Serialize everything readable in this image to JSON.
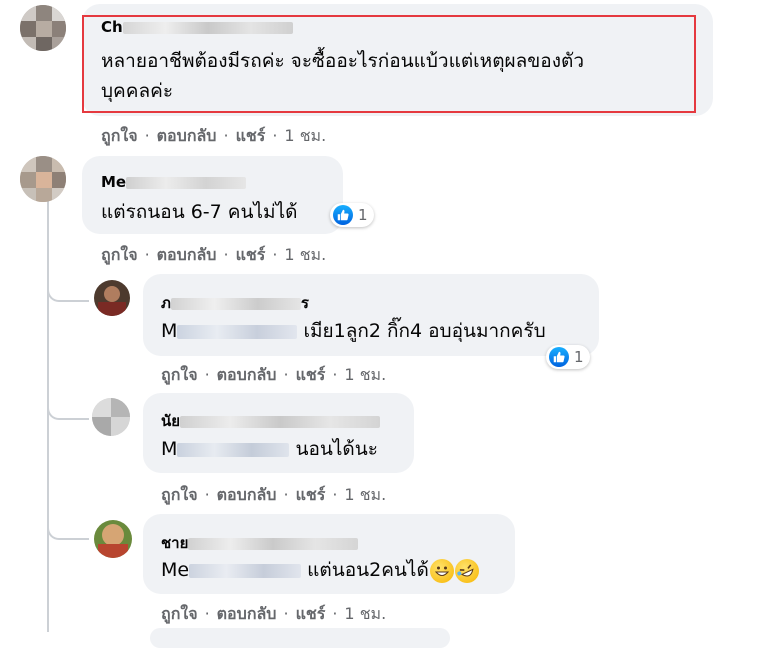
{
  "comments": [
    {
      "name_prefix": "Ch",
      "text_lines": [
        "หลายอาชีพต้องมีรถค่ะ จะซื้ออะไรก่อนแบ้วแต่เหตุผลของตัว",
        "บุคคลค่ะ"
      ],
      "actions": {
        "like": "ถูกใจ",
        "reply": "ตอบกลับ",
        "share": "แชร์",
        "time": "1 ชม."
      }
    },
    {
      "name_prefix": "Me",
      "text": "แต่รถนอน 6-7 คนไม่ได้",
      "reaction_count": "1",
      "actions": {
        "like": "ถูกใจ",
        "reply": "ตอบกลับ",
        "share": "แชร์",
        "time": "1 ชม."
      }
    }
  ],
  "replies": [
    {
      "name_prefix": "ภ",
      "name_suffix": "ร",
      "mention_prefix": "M",
      "text": "เมีย1ลูก2 กิ๊ก4 อบอุ่นมากครับ",
      "reaction_count": "1",
      "actions": {
        "like": "ถูกใจ",
        "reply": "ตอบกลับ",
        "share": "แชร์",
        "time": "1 ชม."
      }
    },
    {
      "name_prefix": "นัย",
      "mention_prefix": "M",
      "text": "นอนได้นะ",
      "actions": {
        "like": "ถูกใจ",
        "reply": "ตอบกลับ",
        "share": "แชร์",
        "time": "1 ชม."
      }
    },
    {
      "name_prefix": "ชาย",
      "mention_prefix": "Me",
      "text": "แต่นอน2คนได้",
      "emojis": [
        "grinning-face-icon",
        "rolling-laughing-icon"
      ],
      "actions": {
        "like": "ถูกใจ",
        "reply": "ตอบกลับ",
        "share": "แชร์",
        "time": "1 ชม."
      }
    }
  ],
  "colors": {
    "bubble": "#f0f2f5",
    "meta": "#65676b",
    "highlight": "#e5393f",
    "like": "#1877f2"
  }
}
